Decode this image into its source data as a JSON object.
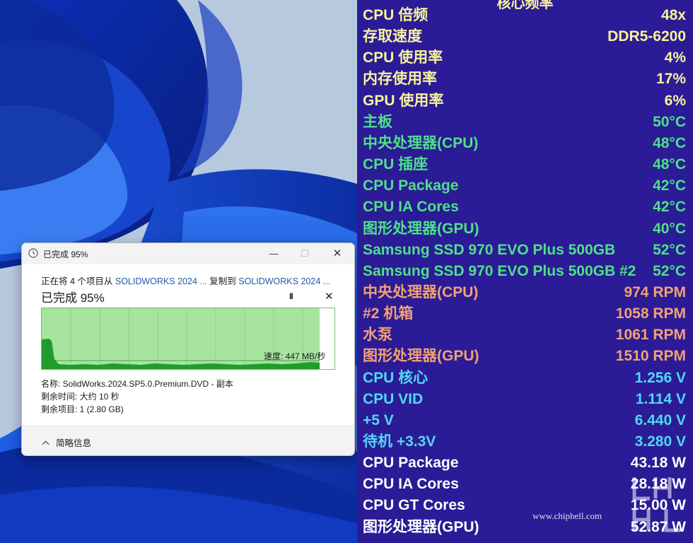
{
  "dialog": {
    "title": "已完成 95%",
    "minimize_symbol": "—",
    "maximize_symbol": "☐",
    "close_symbol": "✕",
    "copy_prefix": "正在将 4 个项目从 ",
    "copy_source": "SOLIDWORKS 2024 ...",
    "copy_middle": " 复制到 ",
    "copy_dest": "SOLIDWORKS 2024 ...",
    "progress_heading": "已完成 95%",
    "progress_fraction": 0.95,
    "pause_symbol": "II",
    "cancel_symbol": "✕",
    "speed_label": "速度: 447 MB/秒",
    "name_line": "名称: SolidWorks.2024.SP5.0.Premium.DVD - 副本",
    "time_line": "剩余时间: 大约 10 秒",
    "items_line": "剩余项目: 1 (2.80 GB)",
    "less_info_label": "简略信息"
  },
  "sensor_panel": {
    "header": "核心频率",
    "colors": {
      "background": "#2b1b96",
      "yellow": "#f7f39a",
      "green": "#4ee08a",
      "orange": "#f2a173",
      "cyan": "#4fd8f5",
      "white": "#ffffff"
    },
    "rows": [
      {
        "label": "CPU 倍频",
        "value": "48x",
        "color": "yellow"
      },
      {
        "label": "存取速度",
        "value": "DDR5-6200",
        "color": "yellow"
      },
      {
        "label": "CPU 使用率",
        "value": "4%",
        "color": "yellow"
      },
      {
        "label": "内存使用率",
        "value": "17%",
        "color": "yellow"
      },
      {
        "label": "GPU 使用率",
        "value": "6%",
        "color": "yellow"
      },
      {
        "label": "主板",
        "value": "50°C",
        "color": "green"
      },
      {
        "label": "中央处理器(CPU)",
        "value": "48°C",
        "color": "green"
      },
      {
        "label": "CPU 插座",
        "value": "48°C",
        "color": "green"
      },
      {
        "label": "CPU Package",
        "value": "42°C",
        "color": "green"
      },
      {
        "label": "CPU IA Cores",
        "value": "42°C",
        "color": "green"
      },
      {
        "label": "图形处理器(GPU)",
        "value": "40°C",
        "color": "green"
      },
      {
        "label": "Samsung SSD 970 EVO Plus 500GB",
        "value": "52°C",
        "color": "green"
      },
      {
        "label": "Samsung SSD 970 EVO Plus 500GB #2",
        "value": "52°C",
        "color": "green"
      },
      {
        "label": "中央处理器(CPU)",
        "value": "974 RPM",
        "color": "orange"
      },
      {
        "label": "#2 机箱",
        "value": "1058 RPM",
        "color": "orange"
      },
      {
        "label": "水泵",
        "value": "1061 RPM",
        "color": "orange"
      },
      {
        "label": "图形处理器(GPU)",
        "value": "1510 RPM",
        "color": "orange"
      },
      {
        "label": "CPU 核心",
        "value": "1.256 V",
        "color": "cyan"
      },
      {
        "label": "CPU VID",
        "value": "1.114 V",
        "color": "cyan"
      },
      {
        "label": "+5 V",
        "value": "6.440 V",
        "color": "cyan"
      },
      {
        "label": "待机 +3.3V",
        "value": "3.280 V",
        "color": "cyan"
      },
      {
        "label": "CPU Package",
        "value": "43.18 W",
        "color": "white"
      },
      {
        "label": "CPU IA Cores",
        "value": "28.18 W",
        "color": "white"
      },
      {
        "label": "CPU GT Cores",
        "value": "15.00 W",
        "color": "white"
      },
      {
        "label": "图形处理器(GPU)",
        "value": "52.87 W",
        "color": "white"
      }
    ],
    "watermark_url": "www.chiphell.com",
    "watermark_logo_text": "chip hell"
  }
}
